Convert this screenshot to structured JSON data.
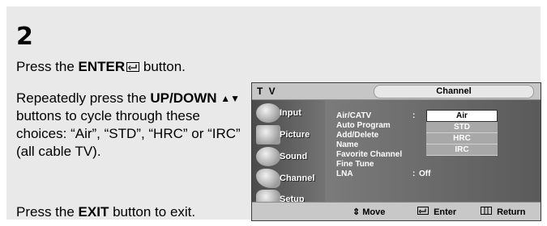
{
  "step": {
    "number": "2"
  },
  "instructions": {
    "line1": {
      "pre": "Press the ",
      "bold": "ENTER",
      "post": " button."
    },
    "line2": {
      "pre": "Repeatedly press the ",
      "bold": "UP/DOWN",
      "arrows": "▲▼",
      "post": " buttons to cycle through these choices: “Air”, “STD”, “HRC” or “IRC” (all cable TV)."
    },
    "line3": {
      "pre": "Press the ",
      "bold": "EXIT",
      "post": " button to exit."
    }
  },
  "tv_menu": {
    "title": "T V",
    "tab": "Channel",
    "sidebar": [
      {
        "label": "Input",
        "icon": "input-icon"
      },
      {
        "label": "Picture",
        "icon": "picture-icon"
      },
      {
        "label": "Sound",
        "icon": "sound-icon"
      },
      {
        "label": "Channel",
        "icon": "channel-icon"
      },
      {
        "label": "Setup",
        "icon": "setup-icon"
      }
    ],
    "items": [
      {
        "label": "Air/CATV",
        "colon": ":"
      },
      {
        "label": "Auto Program"
      },
      {
        "label": "Add/Delete"
      },
      {
        "label": "Name"
      },
      {
        "label": "Favorite Channel"
      },
      {
        "label": "Fine Tune"
      },
      {
        "label": "LNA",
        "colon": ":",
        "value": "Off"
      }
    ],
    "options": [
      "Air",
      "STD",
      "HRC",
      "IRC"
    ],
    "selected_option": "Air",
    "footer": {
      "move": "Move",
      "enter": "Enter",
      "return": "Return"
    }
  }
}
